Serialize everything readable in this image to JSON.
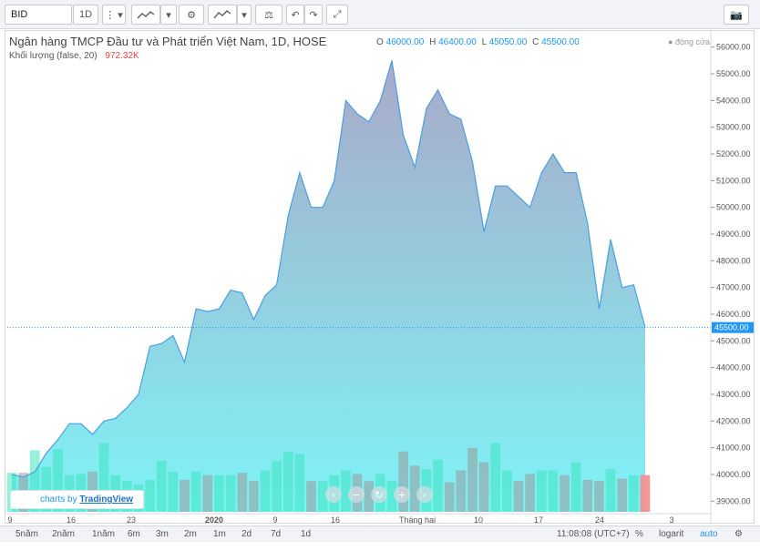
{
  "toolbar": {
    "symbol": "BID",
    "interval": "1D",
    "icons": [
      "more-vert-icon",
      "compare-icon",
      "dropdown-icon",
      "settings-icon",
      "indicators-icon",
      "dropdown-icon",
      "scales-icon",
      "undo-icon",
      "redo-icon",
      "fullscreen-icon",
      "camera-icon"
    ]
  },
  "legend": {
    "title": "Ngân hàng TMCP Đầu tư và Phát triển Việt Nam, 1D, HOSE",
    "volume_label": "Khối lượng (false, 20)",
    "volume_value": "972.32K",
    "o_label": "O",
    "o_value": "46000.00",
    "h_label": "H",
    "h_value": "46400.00",
    "l_label": "L",
    "l_value": "45050.00",
    "c_label": "C",
    "c_value": "45500.00",
    "closing_label": "đóng cửa"
  },
  "price_label": "45500.00",
  "colors": {
    "line": "#4a9fe0",
    "area_top": "#a9a9c8",
    "area_bottom": "#7ff3f7",
    "volume_up": "#3ee3c0",
    "volume_down": "#999999",
    "last_bar": "#f48c8c",
    "accent": "#2196f3"
  },
  "chart_data": {
    "type": "area",
    "y_ticks": [
      "56000.00",
      "55000.00",
      "54000.00",
      "53000.00",
      "52000.00",
      "51000.00",
      "50000.00",
      "49000.00",
      "48000.00",
      "47000.00",
      "46000.00",
      "45000.00",
      "44000.00",
      "43000.00",
      "42000.00",
      "41000.00",
      "40000.00",
      "39000.00"
    ],
    "ylim": [
      38600,
      56400
    ],
    "x_ticks": [
      "9",
      "16",
      "23",
      "2020",
      "9",
      "16",
      "Tháng hai",
      "10",
      "17",
      "24",
      "3"
    ],
    "x": [
      "2019-12-09",
      "2019-12-10",
      "2019-12-11",
      "2019-12-12",
      "2019-12-13",
      "2019-12-16",
      "2019-12-17",
      "2019-12-18",
      "2019-12-19",
      "2019-12-20",
      "2019-12-23",
      "2019-12-24",
      "2019-12-25",
      "2019-12-26",
      "2019-12-27",
      "2019-12-30",
      "2019-12-31",
      "2020-01-02",
      "2020-01-03",
      "2020-01-06",
      "2020-01-07",
      "2020-01-08",
      "2020-01-09",
      "2020-01-10",
      "2020-01-13",
      "2020-01-14",
      "2020-01-15",
      "2020-01-16",
      "2020-01-17",
      "2020-01-20",
      "2020-01-21",
      "2020-01-22",
      "2020-01-30",
      "2020-01-31",
      "2020-02-03",
      "2020-02-04",
      "2020-02-05",
      "2020-02-06",
      "2020-02-07",
      "2020-02-10",
      "2020-02-11",
      "2020-02-12",
      "2020-02-13",
      "2020-02-14",
      "2020-02-17",
      "2020-02-18",
      "2020-02-19",
      "2020-02-20",
      "2020-02-21",
      "2020-02-24",
      "2020-02-25",
      "2020-02-26",
      "2020-02-27",
      "2020-02-28"
    ],
    "values": [
      40000,
      39900,
      40100,
      40800,
      41300,
      41900,
      41900,
      41500,
      42000,
      42100,
      42500,
      43000,
      44800,
      44900,
      45200,
      44200,
      46200,
      46100,
      46200,
      46900,
      46800,
      45800,
      46700,
      47100,
      49700,
      51300,
      50000,
      50000,
      51000,
      54000,
      53500,
      53200,
      54000,
      55500,
      52700,
      51500,
      53700,
      54400,
      53500,
      53300,
      51700,
      49100,
      50800,
      50800,
      50400,
      50000,
      51300,
      52000,
      51300,
      51300,
      49400,
      46200,
      48800,
      47000,
      47100,
      45500
    ],
    "volume": {
      "type": "bar",
      "values_relative": [
        0.33,
        0.33,
        0.52,
        0.38,
        0.53,
        0.31,
        0.32,
        0.34,
        0.58,
        0.31,
        0.26,
        0.23,
        0.27,
        0.43,
        0.34,
        0.27,
        0.34,
        0.31,
        0.31,
        0.31,
        0.33,
        0.26,
        0.35,
        0.43,
        0.51,
        0.49,
        0.26,
        0.26,
        0.31,
        0.35,
        0.32,
        0.26,
        0.32,
        0.26,
        0.51,
        0.39,
        0.36,
        0.44,
        0.25,
        0.35,
        0.54,
        0.42,
        0.58,
        0.35,
        0.26,
        0.32,
        0.35,
        0.35,
        0.31,
        0.42,
        0.27,
        0.26,
        0.36,
        0.28,
        0.31,
        0.31
      ],
      "last_value": "972.32K"
    }
  },
  "bottom": {
    "ranges": [
      "5năm",
      "2năm",
      "1năm",
      "6m",
      "3m",
      "2m",
      "1m",
      "2d",
      "7d",
      "1d"
    ],
    "time": "11:08:08 (UTC+7)",
    "percent": "%",
    "log": "logarit",
    "auto": "auto"
  },
  "badge": {
    "prefix": "charts by",
    "brand": "TradingView"
  }
}
